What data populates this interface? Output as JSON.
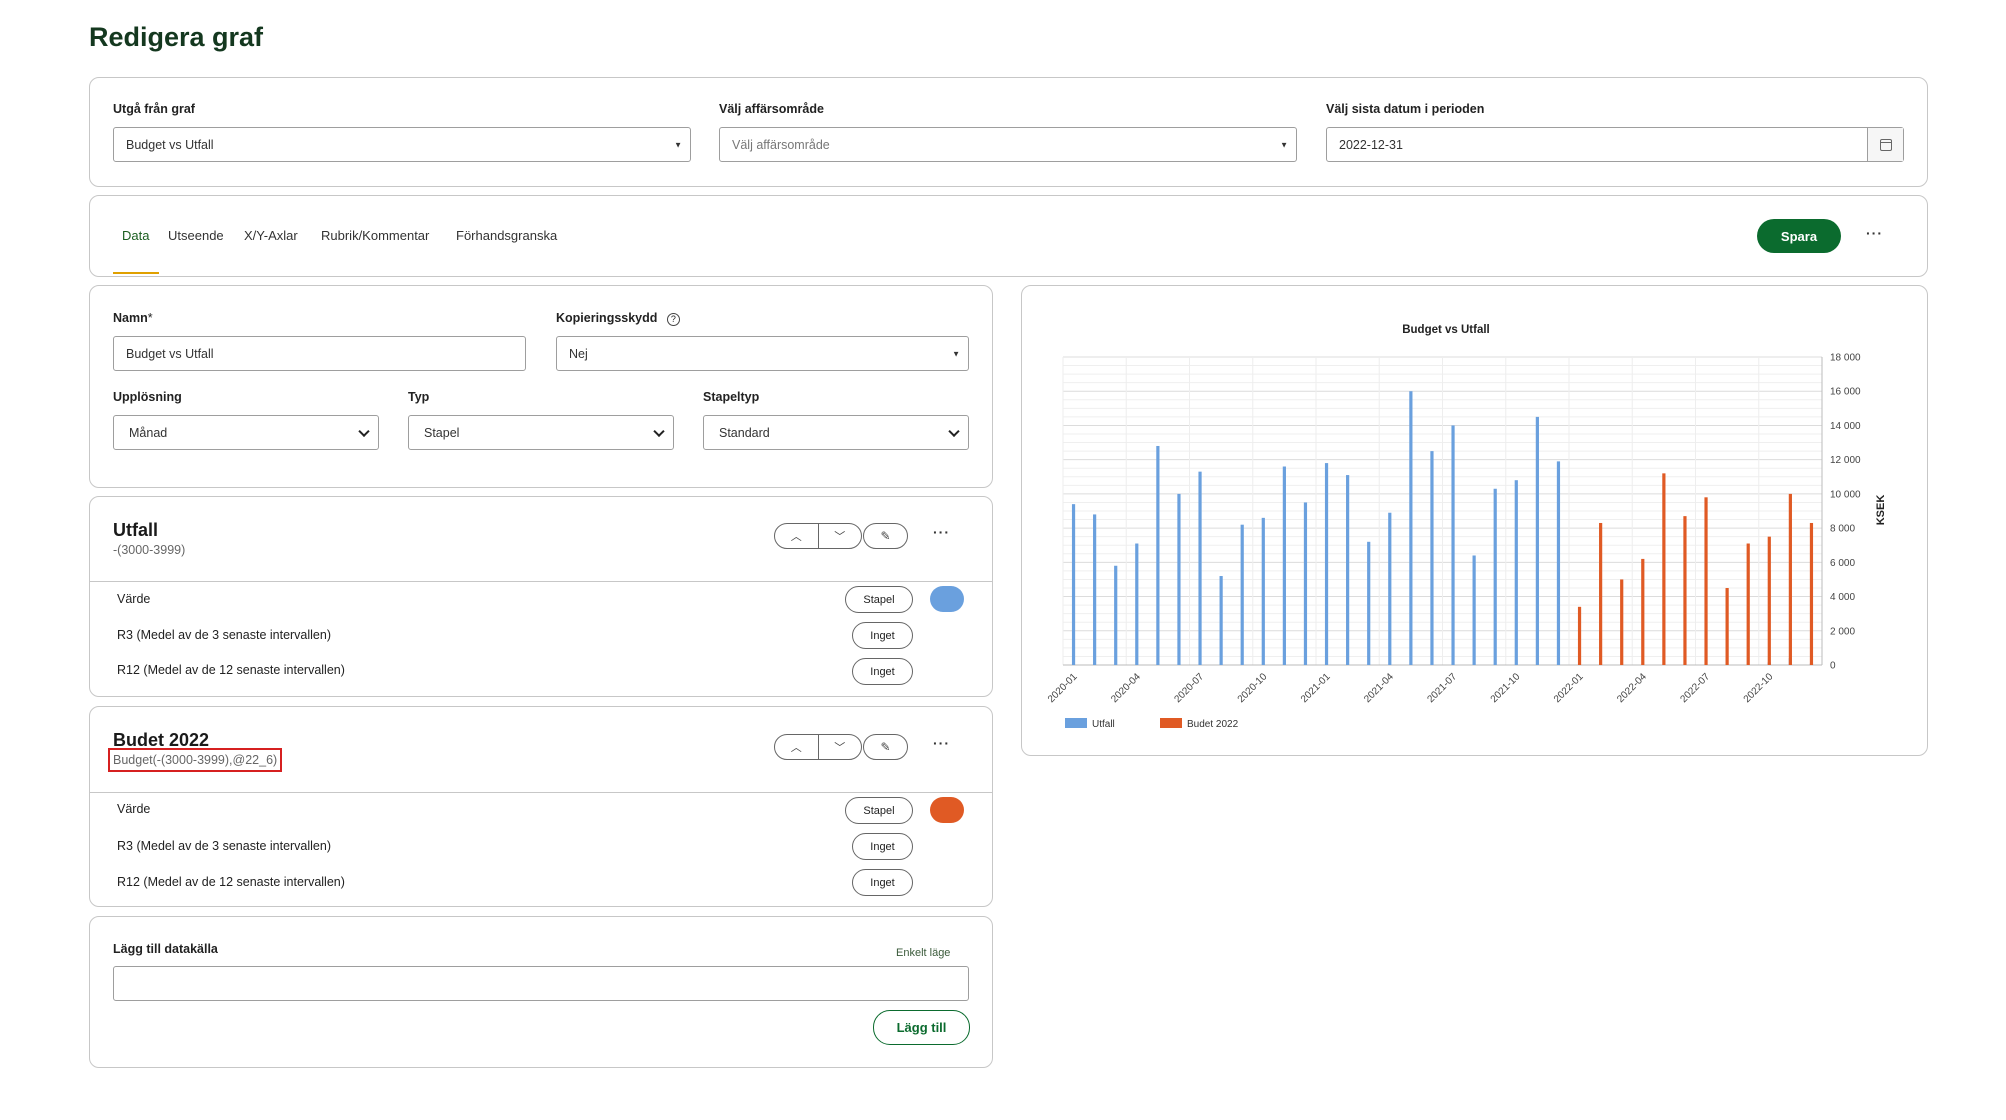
{
  "page": {
    "title": "Redigera graf"
  },
  "top_filters": {
    "graph_label": "Utgå från graf",
    "graph_value": "Budget vs Utfall",
    "area_label": "Välj affärsområde",
    "area_placeholder": "Välj affärsområde",
    "date_label": "Välj sista datum i perioden",
    "date_value": "2022-12-31"
  },
  "tabs": [
    {
      "label": "Data",
      "active": true
    },
    {
      "label": "Utseende"
    },
    {
      "label": "X/Y-Axlar"
    },
    {
      "label": "Rubrik/Kommentar"
    },
    {
      "label": "Förhandsgranska"
    }
  ],
  "toolbar": {
    "save_label": "Spara",
    "more_label": "···"
  },
  "settings": {
    "name_label": "Namn",
    "name_required_mark": "*",
    "name_value": "Budget vs Utfall",
    "copy_label": "Kopieringsskydd",
    "copy_value": "Nej",
    "resolution_label": "Upplösning",
    "resolution_value": "Månad",
    "type_label": "Typ",
    "type_value": "Stapel",
    "bar_type_label": "Stapeltyp",
    "bar_type_value": "Standard"
  },
  "series": [
    {
      "title": "Utfall",
      "formula": "-(3000-3999)",
      "color": "#6aa0de",
      "rows": [
        {
          "label": "Värde",
          "mode": "Stapel"
        },
        {
          "label": "R3 (Medel av de 3 senaste intervallen)",
          "mode": "Inget"
        },
        {
          "label": "R12 (Medel av de 12 senaste intervallen)",
          "mode": "Inget"
        }
      ]
    },
    {
      "title": "Budet 2022",
      "formula": "Budget(-(3000-3999),@22_6)",
      "color": "#e05a24",
      "rows": [
        {
          "label": "Värde",
          "mode": "Stapel"
        },
        {
          "label": "R3 (Medel av de 3 senaste intervallen)",
          "mode": "Inget"
        },
        {
          "label": "R12 (Medel av de 12 senaste intervallen)",
          "mode": "Inget"
        }
      ]
    }
  ],
  "add_source": {
    "label": "Lägg till datakälla",
    "simple_mode": "Enkelt läge",
    "value": "",
    "button": "Lägg till"
  },
  "chart_data": {
    "type": "bar",
    "title": "Budget vs Utfall",
    "ylabel": "KSEK",
    "xlabel": "",
    "ylim": [
      0,
      18000
    ],
    "y_ticks": [
      "0",
      "2 000",
      "4 000",
      "6 000",
      "8 000",
      "10 000",
      "12 000",
      "14 000",
      "16 000",
      "18 000"
    ],
    "categories": [
      "2020-01",
      "2020-02",
      "2020-03",
      "2020-04",
      "2020-05",
      "2020-06",
      "2020-07",
      "2020-08",
      "2020-09",
      "2020-10",
      "2020-11",
      "2020-12",
      "2021-01",
      "2021-02",
      "2021-03",
      "2021-04",
      "2021-05",
      "2021-06",
      "2021-07",
      "2021-08",
      "2021-09",
      "2021-10",
      "2021-11",
      "2021-12",
      "2022-01",
      "2022-02",
      "2022-03",
      "2022-04",
      "2022-05",
      "2022-06",
      "2022-07",
      "2022-08",
      "2022-09",
      "2022-10",
      "2022-11",
      "2022-12"
    ],
    "x_tick_labels": [
      "2020-01",
      "2020-04",
      "2020-07",
      "2020-10",
      "2021-01",
      "2021-04",
      "2021-07",
      "2021-10",
      "2022-01",
      "2022-04",
      "2022-07",
      "2022-10"
    ],
    "series": [
      {
        "name": "Utfall",
        "color": "#6aa0de",
        "values": [
          9400,
          8800,
          5800,
          7100,
          12800,
          10000,
          11300,
          5200,
          8200,
          8600,
          11600,
          9500,
          11800,
          11100,
          7200,
          8900,
          16000,
          12500,
          14000,
          6400,
          10300,
          10800,
          14500,
          11900,
          0,
          0,
          0,
          0,
          0,
          0,
          0,
          0,
          0,
          150,
          400,
          100
        ]
      },
      {
        "name": "Budet 2022",
        "color": "#e05a24",
        "values": [
          0,
          0,
          0,
          0,
          0,
          0,
          0,
          0,
          0,
          0,
          0,
          0,
          0,
          0,
          0,
          0,
          0,
          0,
          0,
          0,
          0,
          0,
          0,
          0,
          3400,
          8300,
          5000,
          6200,
          11200,
          8700,
          9800,
          4500,
          7100,
          7500,
          10000,
          8300
        ]
      }
    ],
    "legend": "bottom-left",
    "grid": true
  }
}
